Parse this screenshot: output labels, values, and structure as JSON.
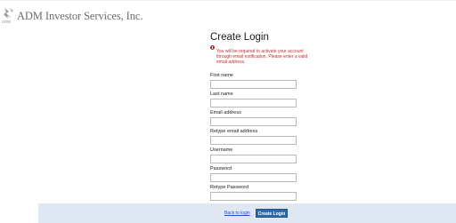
{
  "header": {
    "logo_text": "ADM",
    "company_name": "ADM Investor Services, Inc."
  },
  "form": {
    "title": "Create Login",
    "alert": "You will be required to activate your account through email notification. Please enter a valid email address.",
    "fields": [
      {
        "label": "First name",
        "value": ""
      },
      {
        "label": "Last name",
        "value": ""
      },
      {
        "label": "Email address",
        "value": ""
      },
      {
        "label": "Retype email address",
        "value": ""
      },
      {
        "label": "Username",
        "value": ""
      },
      {
        "label": "Password",
        "value": ""
      },
      {
        "label": "Retype Password",
        "value": ""
      }
    ]
  },
  "footer": {
    "back_link": "Back to login",
    "submit_label": "Create Login"
  },
  "colors": {
    "alert": "#cc1f1f",
    "primary_button": "#2d6ca8",
    "footer_bg": "#dfe8f2",
    "link": "#1f4fd0"
  },
  "icons": {
    "alert": "alert-icon",
    "logo": "adm-logo-icon"
  }
}
